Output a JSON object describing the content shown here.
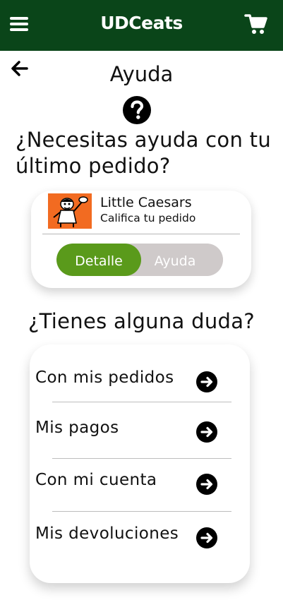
{
  "app": {
    "brand": "UDCeats"
  },
  "page": {
    "title": "Ayuda",
    "question": "¿Necesitas ayuda con tu último pedido?"
  },
  "last_order": {
    "restaurant": "Little Caesars",
    "rate_label": "Califica tu pedido",
    "toggle": {
      "detail_label": "Detalle",
      "help_label": "Ayuda",
      "selected": "Detalle"
    }
  },
  "faq": {
    "title": "¿Tienes alguna duda?",
    "items": [
      {
        "label": "Con mis pedidos"
      },
      {
        "label": "Mis pagos"
      },
      {
        "label": "Con mi cuenta"
      },
      {
        "label": "Mis devoluciones"
      }
    ]
  },
  "colors": {
    "header": "#0a4519",
    "toggle_active": "#5a9a1b",
    "toggle_inactive": "#cfcaca",
    "logo_bg": "#f26b21"
  },
  "icons": [
    "menu-icon",
    "cart-icon",
    "back-arrow-icon",
    "help-circle-icon",
    "arrow-right-circle-icon"
  ]
}
